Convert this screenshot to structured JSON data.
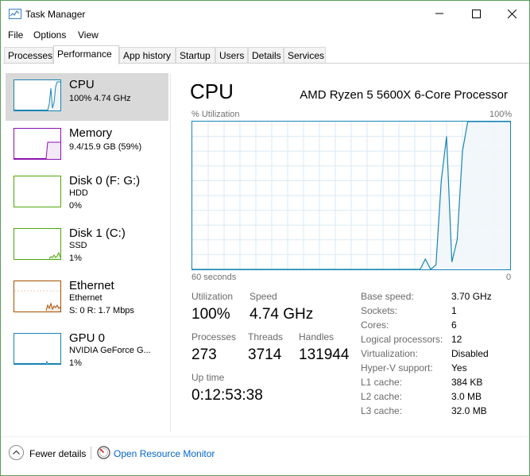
{
  "window": {
    "title": "Task Manager"
  },
  "menu": [
    "File",
    "Options",
    "View"
  ],
  "tabs": [
    {
      "label": "Processes",
      "active": false
    },
    {
      "label": "Performance",
      "active": true
    },
    {
      "label": "App history",
      "active": false
    },
    {
      "label": "Startup",
      "active": false
    },
    {
      "label": "Users",
      "active": false
    },
    {
      "label": "Details",
      "active": false
    },
    {
      "label": "Services",
      "active": false
    }
  ],
  "sidebar": {
    "items": [
      {
        "title": "CPU",
        "lines": [
          "100% 4.74 GHz"
        ],
        "color": "#1784b3",
        "selected": true,
        "icon": "cpu-graph-thumbnail"
      },
      {
        "title": "Memory",
        "lines": [
          "9.4/15.9 GB (59%)"
        ],
        "color": "#8b12ae",
        "selected": false,
        "icon": "memory-graph-thumbnail"
      },
      {
        "title": "Disk 0 (F: G:)",
        "lines": [
          "HDD",
          "0%"
        ],
        "color": "#4da60c",
        "selected": false,
        "icon": "disk-graph-thumbnail"
      },
      {
        "title": "Disk 1 (C:)",
        "lines": [
          "SSD",
          "1%"
        ],
        "color": "#4da60c",
        "selected": false,
        "icon": "disk-graph-thumbnail"
      },
      {
        "title": "Ethernet",
        "lines": [
          "Ethernet",
          "S: 0 R: 1.7 Mbps"
        ],
        "color": "#a74f01",
        "selected": false,
        "icon": "network-graph-thumbnail"
      },
      {
        "title": "GPU 0",
        "lines": [
          "NVIDIA GeForce G...",
          "1%"
        ],
        "color": "#1784b3",
        "selected": false,
        "icon": "gpu-graph-thumbnail"
      }
    ]
  },
  "main": {
    "title": "CPU",
    "processor": "AMD Ryzen 5 5600X 6-Core Processor",
    "util_label": "% Utilization",
    "y_max": "100%",
    "x_left": "60 seconds",
    "x_right": "0",
    "stats": {
      "utilization_label": "Utilization",
      "utilization_value": "100%",
      "speed_label": "Speed",
      "speed_value": "4.74 GHz",
      "processes_label": "Processes",
      "processes_value": "273",
      "threads_label": "Threads",
      "threads_value": "3714",
      "handles_label": "Handles",
      "handles_value": "131944",
      "uptime_label": "Up time",
      "uptime_value": "0:12:53:38"
    },
    "specs": [
      {
        "label": "Base speed:",
        "value": "3.70 GHz"
      },
      {
        "label": "Sockets:",
        "value": "1"
      },
      {
        "label": "Cores:",
        "value": "6"
      },
      {
        "label": "Logical processors:",
        "value": "12"
      },
      {
        "label": "Virtualization:",
        "value": "Disabled"
      },
      {
        "label": "Hyper-V support:",
        "value": "Yes"
      },
      {
        "label": "L1 cache:",
        "value": "384 KB"
      },
      {
        "label": "L2 cache:",
        "value": "3.0 MB"
      },
      {
        "label": "L3 cache:",
        "value": "32.0 MB"
      }
    ]
  },
  "footer": {
    "fewer_details": "Fewer details",
    "open_monitor": "Open Resource Monitor"
  },
  "colors": {
    "cpu_accent": "#1784b3",
    "cpu_fill": "#f1f6fa",
    "grid": "#d9eaf4",
    "link": "#0066cc",
    "selected_bg": "#d9d9d9"
  },
  "chart_data": {
    "type": "area",
    "xlabel": "60 seconds",
    "ylabel": "% Utilization",
    "xlim": [
      60,
      0
    ],
    "ylim": [
      0,
      100
    ],
    "grid": true,
    "series": [
      {
        "x": [
          60,
          50,
          40,
          30,
          20,
          17,
          16,
          15,
          14,
          13,
          12,
          11,
          10,
          9,
          8,
          7,
          6,
          5,
          4,
          3,
          2,
          1,
          0
        ],
        "values": [
          0,
          0,
          0,
          0,
          0,
          0,
          7,
          0,
          3,
          60,
          90,
          5,
          20,
          80,
          100,
          100,
          100,
          100,
          100,
          100,
          100,
          100,
          100
        ]
      }
    ]
  }
}
